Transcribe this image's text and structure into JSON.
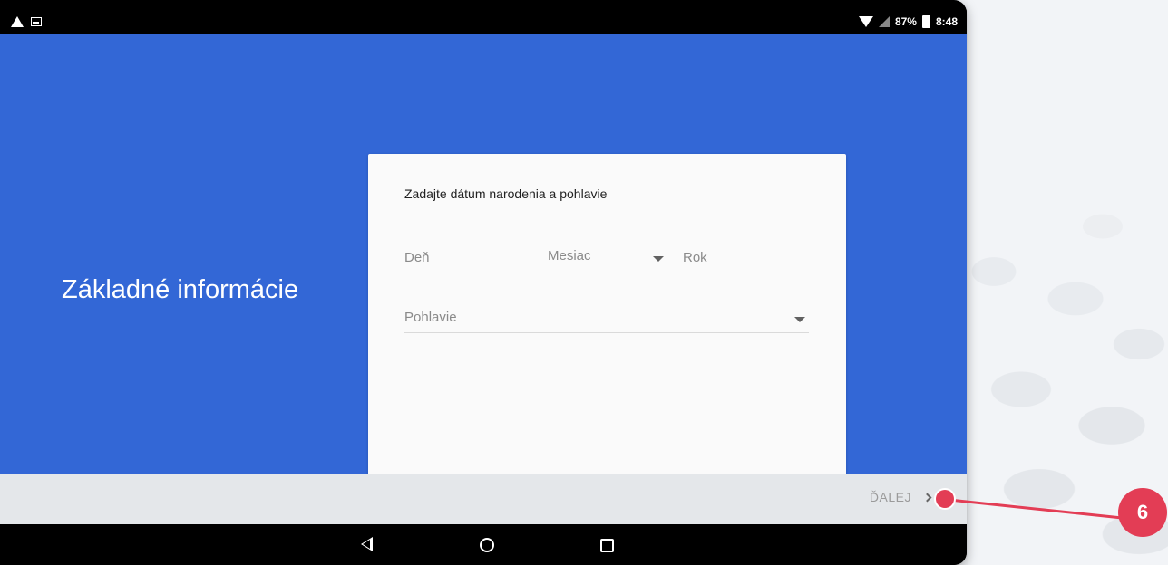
{
  "status_bar": {
    "battery_percent": "87%",
    "time": "8:48"
  },
  "page": {
    "title": "Základné informácie"
  },
  "form": {
    "heading": "Zadajte dátum narodenia a pohlavie",
    "day_placeholder": "Deň",
    "month_placeholder": "Mesiac",
    "year_placeholder": "Rok",
    "gender_placeholder": "Pohlavie"
  },
  "footer": {
    "next_label": "ĎALEJ"
  },
  "annotation": {
    "step_number": "6"
  },
  "colors": {
    "primary": "#3367d6",
    "footer_bg": "#e4e7ea",
    "annotation": "#e33d55"
  }
}
